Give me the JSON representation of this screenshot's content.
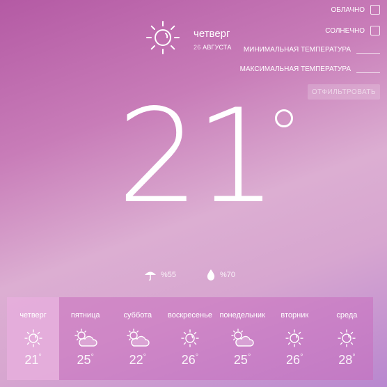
{
  "header": {
    "day": "четверг",
    "date_num": "26",
    "date_month": "АВГУСТА",
    "icon": "sun-icon"
  },
  "filters": {
    "cloudy": "ОБЛАЧНО",
    "sunny": "СОЛНЕЧНО",
    "min_temp": "МИНИМАЛЬНАЯ ТЕМПЕРАТУРА",
    "max_temp": "МАКСИМАЛЬНАЯ ТЕМПЕРАТУРА",
    "button": "ОТФИЛЬТРОВАТЬ"
  },
  "current": {
    "temperature": "21",
    "precipitation": "%55",
    "humidity": "%70"
  },
  "forecast": [
    {
      "day": "четверг",
      "temp": "21",
      "icon": "sun-icon",
      "active": true
    },
    {
      "day": "пятница",
      "temp": "25",
      "icon": "partly-cloudy-icon"
    },
    {
      "day": "суббота",
      "temp": "22",
      "icon": "partly-cloudy-icon"
    },
    {
      "day": "воскресенье",
      "temp": "26",
      "icon": "sun-icon"
    },
    {
      "day": "понедельник",
      "temp": "25",
      "icon": "partly-cloudy-icon"
    },
    {
      "day": "вторник",
      "temp": "26",
      "icon": "sun-icon"
    },
    {
      "day": "среда",
      "temp": "28",
      "icon": "sun-icon"
    }
  ]
}
